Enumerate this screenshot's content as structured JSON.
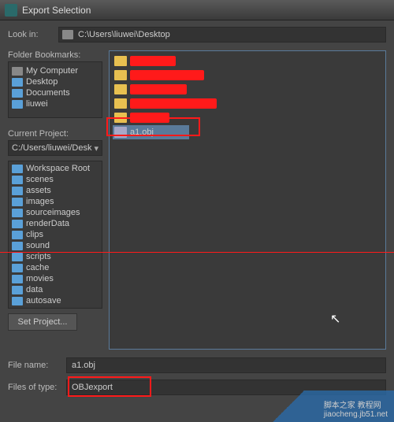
{
  "window": {
    "title": "Export Selection"
  },
  "lookin": {
    "label": "Look in:",
    "path": "C:\\Users\\liuwei\\Desktop"
  },
  "folderBookmarks": {
    "title": "Folder Bookmarks:",
    "items": [
      {
        "label": "My Computer",
        "icon": "monitor"
      },
      {
        "label": "Desktop",
        "icon": "folder"
      },
      {
        "label": "Documents",
        "icon": "folder"
      },
      {
        "label": "liuwei",
        "icon": "folder"
      }
    ]
  },
  "currentProject": {
    "title": "Current Project:",
    "path": "C:/Users/liuwei/Desk",
    "tree": [
      "Workspace Root",
      "scenes",
      "assets",
      "images",
      "sourceimages",
      "renderData",
      "clips",
      "sound",
      "scripts",
      "cache",
      "movies",
      "data",
      "autosave"
    ]
  },
  "setProject": {
    "label": "Set Project..."
  },
  "filePane": {
    "selected": {
      "name": "a1.obj",
      "type": "obj"
    },
    "redactedFolders": 5
  },
  "fileName": {
    "label": "File name:",
    "value": "a1.obj"
  },
  "filesOfType": {
    "label": "Files of type:",
    "value": "OBJexport"
  },
  "watermark": {
    "line1": "脚本之家 教程网",
    "line2": "jiaocheng.jb51.net"
  }
}
